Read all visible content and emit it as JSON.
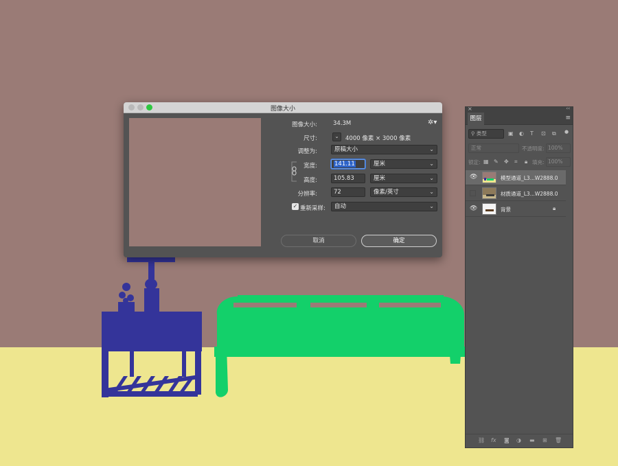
{
  "dialog": {
    "title": "图像大小",
    "image_size_label": "图像大小:",
    "image_size_value": "34.3M",
    "dimensions_label": "尺寸:",
    "dimensions_value": "4000 像素  ×  3000 像素",
    "fit_to_label": "调整为:",
    "fit_to_value": "原稿大小",
    "width_label": "宽度:",
    "width_value": "141.11",
    "width_unit": "厘米",
    "height_label": "高度:",
    "height_value": "105.83",
    "height_unit": "厘米",
    "resolution_label": "分辨率:",
    "resolution_value": "72",
    "resolution_unit": "像素/英寸",
    "resample_label": "重新采样:",
    "resample_value": "自动",
    "resample_checked": true,
    "cancel_label": "取消",
    "ok_label": "确定",
    "settings_icon": "gear-icon",
    "link_icon": "chain-link-icon"
  },
  "layers_panel": {
    "tab_label": "图层",
    "filter_kind": "类型",
    "blend_mode": "正常",
    "opacity_label": "不透明度:",
    "opacity_value": "100%",
    "lock_label": "锁定:",
    "fill_label": "填充:",
    "fill_value": "100%",
    "layers": [
      {
        "name": "模型通道_L3...W2888.0",
        "visible": true,
        "selected": true
      },
      {
        "name": "材质通道_L3...W2888.0",
        "visible": false,
        "selected": false
      },
      {
        "name": "背景",
        "visible": true,
        "selected": false,
        "locked": true
      }
    ],
    "footer_icons": [
      "link-layers-icon",
      "fx-icon",
      "mask-icon",
      "adjustment-icon",
      "folder-icon",
      "new-layer-icon",
      "trash-icon"
    ]
  },
  "colors": {
    "wall": "#9a7b76",
    "floor": "#eee68f",
    "side_table": "#34349a",
    "sofa": "#13d06a",
    "dialog_bg": "#535353"
  }
}
